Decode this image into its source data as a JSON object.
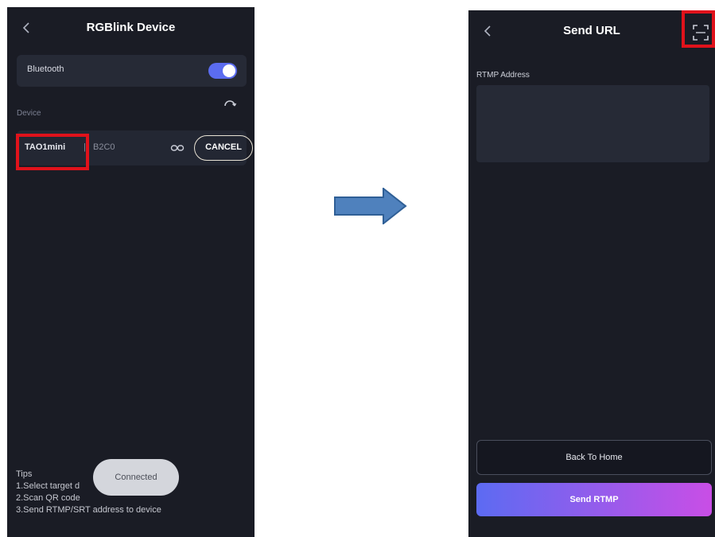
{
  "left_screen": {
    "title": "RGBlink Device",
    "bluetooth_label": "Bluetooth",
    "bluetooth_on": true,
    "device_section_label": "Device",
    "device": {
      "name": "TAO1mini",
      "separator": "|",
      "id": "B2C0",
      "cancel_label": "CANCEL"
    },
    "tips": {
      "heading": "Tips",
      "lines": [
        "1.Select target d",
        "2.Scan QR code",
        "3.Send RTMP/SRT address to device"
      ]
    },
    "toast": "Connected"
  },
  "right_screen": {
    "title": "Send URL",
    "rtmp_label": "RTMP Address",
    "rtmp_value": "",
    "back_home_label": "Back To Home",
    "send_label": "Send RTMP"
  },
  "colors": {
    "phone_bg": "#1a1c25",
    "highlight": "#e0121b",
    "arrow": "#4f81bd",
    "accent_start": "#5c6bf2",
    "accent_end": "#c94ee6"
  }
}
